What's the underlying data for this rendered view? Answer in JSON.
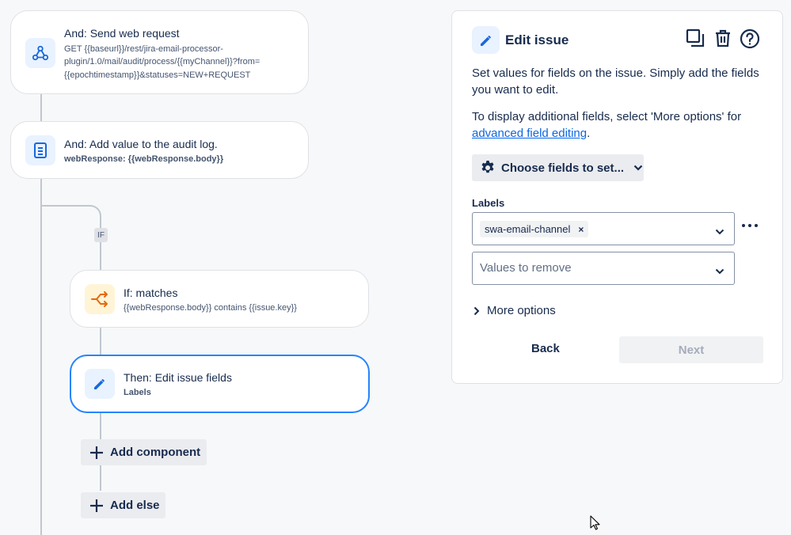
{
  "flow": {
    "send_web_request": {
      "title": "And: Send web request",
      "detail_line1": "GET {{baseurl}}/rest/jira-email-processor-",
      "detail_line2": "plugin/1.0/mail/audit/process/{{myChannel}}?from=",
      "detail_line3": "{{epochtimestamp}}&statuses=NEW+REQUEST",
      "icon": "webhook-icon"
    },
    "audit_log": {
      "title": "And: Add value to the audit log.",
      "detail": "webResponse: {{webResponse.body}}",
      "icon": "document-icon"
    },
    "if_tag": "IF",
    "if_matches": {
      "title": "If: matches",
      "detail": "{{webResponse.body}} contains {{issue.key}}",
      "icon": "branch-icon"
    },
    "edit_fields": {
      "title": "Then: Edit issue fields",
      "detail": "Labels",
      "icon": "pencil-icon"
    },
    "add_component_label": "Add component",
    "add_else_label": "Add else"
  },
  "panel": {
    "title": "Edit issue",
    "description": "Set values for fields on the issue. Simply add the fields you want to edit.",
    "hint_prefix": "To display additional fields, select 'More options' for ",
    "hint_link": "advanced field editing",
    "hint_suffix": ".",
    "choose_fields_label": "Choose fields to set...",
    "labels_field_label": "Labels",
    "labels_chip": "swa-email-channel",
    "chip_remove": "×",
    "remove_placeholder": "Values to remove",
    "more_options_label": "More options",
    "back_label": "Back",
    "next_label": "Next",
    "icons": [
      "copy-icon",
      "trash-icon",
      "help-icon"
    ]
  },
  "colors": {
    "accent": "#2684ff",
    "link": "#0c66e4",
    "icon_blue": "#1868db",
    "icon_orange": "#e56910"
  }
}
